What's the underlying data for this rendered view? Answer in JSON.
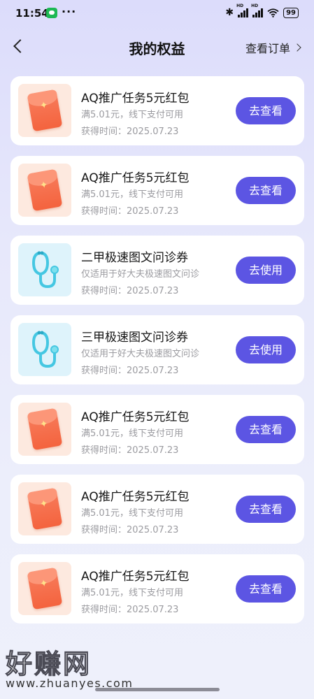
{
  "status_bar": {
    "time": "11:54",
    "battery": "99",
    "network": "HD"
  },
  "nav": {
    "title": "我的权益",
    "orders_label": "查看订单"
  },
  "cards": [
    {
      "icon": "red-envelope-icon",
      "title": "AQ推广任务5元红包",
      "subtitle": "满5.01元，线下支付可用",
      "date": "获得时间：2025.07.23",
      "button": "去查看"
    },
    {
      "icon": "red-envelope-icon",
      "title": "AQ推广任务5元红包",
      "subtitle": "满5.01元，线下支付可用",
      "date": "获得时间：2025.07.23",
      "button": "去查看"
    },
    {
      "icon": "stethoscope-icon",
      "title": "二甲极速图文问诊券",
      "subtitle": "仅适用于好大夫极速图文问诊",
      "date": "获得时间：2025.07.23",
      "button": "去使用"
    },
    {
      "icon": "stethoscope-icon",
      "title": "三甲极速图文问诊券",
      "subtitle": "仅适用于好大夫极速图文问诊",
      "date": "获得时间：2025.07.23",
      "button": "去使用"
    },
    {
      "icon": "red-envelope-icon",
      "title": "AQ推广任务5元红包",
      "subtitle": "满5.01元，线下支付可用",
      "date": "获得时间：2025.07.23",
      "button": "去查看"
    },
    {
      "icon": "red-envelope-icon",
      "title": "AQ推广任务5元红包",
      "subtitle": "满5.01元，线下支付可用",
      "date": "获得时间：2025.07.23",
      "button": "去查看"
    },
    {
      "icon": "red-envelope-icon",
      "title": "AQ推广任务5元红包",
      "subtitle": "满5.01元，线下支付可用",
      "date": "获得时间：2025.07.23",
      "button": "去查看"
    }
  ],
  "watermark": {
    "text": "好赚网",
    "url": "www.zhuanyes.com"
  },
  "colors": {
    "button": "#5c55e3",
    "background": "#e3e4fb",
    "envelope": "#f4633e",
    "stethoscope": "#3fc6e0"
  }
}
